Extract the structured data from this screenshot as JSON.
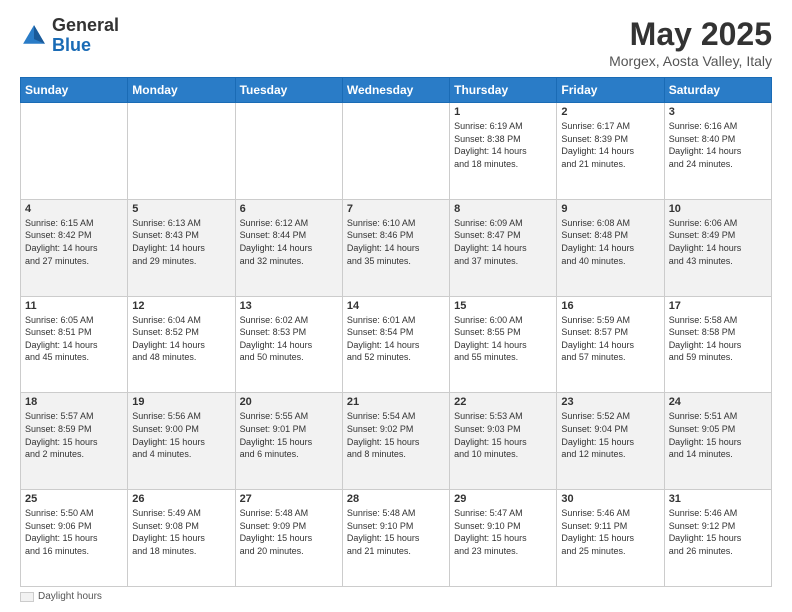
{
  "header": {
    "logo_general": "General",
    "logo_blue": "Blue",
    "month_title": "May 2025",
    "location": "Morgex, Aosta Valley, Italy"
  },
  "weekdays": [
    "Sunday",
    "Monday",
    "Tuesday",
    "Wednesday",
    "Thursday",
    "Friday",
    "Saturday"
  ],
  "weeks": [
    [
      {
        "day": "",
        "info": ""
      },
      {
        "day": "",
        "info": ""
      },
      {
        "day": "",
        "info": ""
      },
      {
        "day": "",
        "info": ""
      },
      {
        "day": "1",
        "info": "Sunrise: 6:19 AM\nSunset: 8:38 PM\nDaylight: 14 hours\nand 18 minutes."
      },
      {
        "day": "2",
        "info": "Sunrise: 6:17 AM\nSunset: 8:39 PM\nDaylight: 14 hours\nand 21 minutes."
      },
      {
        "day": "3",
        "info": "Sunrise: 6:16 AM\nSunset: 8:40 PM\nDaylight: 14 hours\nand 24 minutes."
      }
    ],
    [
      {
        "day": "4",
        "info": "Sunrise: 6:15 AM\nSunset: 8:42 PM\nDaylight: 14 hours\nand 27 minutes."
      },
      {
        "day": "5",
        "info": "Sunrise: 6:13 AM\nSunset: 8:43 PM\nDaylight: 14 hours\nand 29 minutes."
      },
      {
        "day": "6",
        "info": "Sunrise: 6:12 AM\nSunset: 8:44 PM\nDaylight: 14 hours\nand 32 minutes."
      },
      {
        "day": "7",
        "info": "Sunrise: 6:10 AM\nSunset: 8:46 PM\nDaylight: 14 hours\nand 35 minutes."
      },
      {
        "day": "8",
        "info": "Sunrise: 6:09 AM\nSunset: 8:47 PM\nDaylight: 14 hours\nand 37 minutes."
      },
      {
        "day": "9",
        "info": "Sunrise: 6:08 AM\nSunset: 8:48 PM\nDaylight: 14 hours\nand 40 minutes."
      },
      {
        "day": "10",
        "info": "Sunrise: 6:06 AM\nSunset: 8:49 PM\nDaylight: 14 hours\nand 43 minutes."
      }
    ],
    [
      {
        "day": "11",
        "info": "Sunrise: 6:05 AM\nSunset: 8:51 PM\nDaylight: 14 hours\nand 45 minutes."
      },
      {
        "day": "12",
        "info": "Sunrise: 6:04 AM\nSunset: 8:52 PM\nDaylight: 14 hours\nand 48 minutes."
      },
      {
        "day": "13",
        "info": "Sunrise: 6:02 AM\nSunset: 8:53 PM\nDaylight: 14 hours\nand 50 minutes."
      },
      {
        "day": "14",
        "info": "Sunrise: 6:01 AM\nSunset: 8:54 PM\nDaylight: 14 hours\nand 52 minutes."
      },
      {
        "day": "15",
        "info": "Sunrise: 6:00 AM\nSunset: 8:55 PM\nDaylight: 14 hours\nand 55 minutes."
      },
      {
        "day": "16",
        "info": "Sunrise: 5:59 AM\nSunset: 8:57 PM\nDaylight: 14 hours\nand 57 minutes."
      },
      {
        "day": "17",
        "info": "Sunrise: 5:58 AM\nSunset: 8:58 PM\nDaylight: 14 hours\nand 59 minutes."
      }
    ],
    [
      {
        "day": "18",
        "info": "Sunrise: 5:57 AM\nSunset: 8:59 PM\nDaylight: 15 hours\nand 2 minutes."
      },
      {
        "day": "19",
        "info": "Sunrise: 5:56 AM\nSunset: 9:00 PM\nDaylight: 15 hours\nand 4 minutes."
      },
      {
        "day": "20",
        "info": "Sunrise: 5:55 AM\nSunset: 9:01 PM\nDaylight: 15 hours\nand 6 minutes."
      },
      {
        "day": "21",
        "info": "Sunrise: 5:54 AM\nSunset: 9:02 PM\nDaylight: 15 hours\nand 8 minutes."
      },
      {
        "day": "22",
        "info": "Sunrise: 5:53 AM\nSunset: 9:03 PM\nDaylight: 15 hours\nand 10 minutes."
      },
      {
        "day": "23",
        "info": "Sunrise: 5:52 AM\nSunset: 9:04 PM\nDaylight: 15 hours\nand 12 minutes."
      },
      {
        "day": "24",
        "info": "Sunrise: 5:51 AM\nSunset: 9:05 PM\nDaylight: 15 hours\nand 14 minutes."
      }
    ],
    [
      {
        "day": "25",
        "info": "Sunrise: 5:50 AM\nSunset: 9:06 PM\nDaylight: 15 hours\nand 16 minutes."
      },
      {
        "day": "26",
        "info": "Sunrise: 5:49 AM\nSunset: 9:08 PM\nDaylight: 15 hours\nand 18 minutes."
      },
      {
        "day": "27",
        "info": "Sunrise: 5:48 AM\nSunset: 9:09 PM\nDaylight: 15 hours\nand 20 minutes."
      },
      {
        "day": "28",
        "info": "Sunrise: 5:48 AM\nSunset: 9:10 PM\nDaylight: 15 hours\nand 21 minutes."
      },
      {
        "day": "29",
        "info": "Sunrise: 5:47 AM\nSunset: 9:10 PM\nDaylight: 15 hours\nand 23 minutes."
      },
      {
        "day": "30",
        "info": "Sunrise: 5:46 AM\nSunset: 9:11 PM\nDaylight: 15 hours\nand 25 minutes."
      },
      {
        "day": "31",
        "info": "Sunrise: 5:46 AM\nSunset: 9:12 PM\nDaylight: 15 hours\nand 26 minutes."
      }
    ]
  ],
  "footer": {
    "daylight_label": "Daylight hours"
  }
}
